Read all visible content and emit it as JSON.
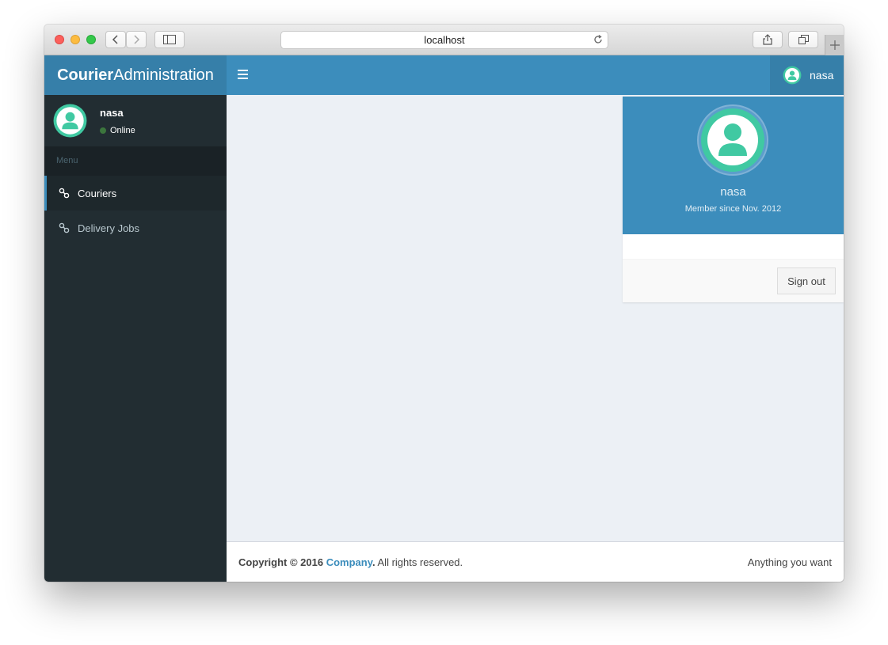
{
  "browser": {
    "address": "localhost"
  },
  "header": {
    "logo_bold": "Courier",
    "logo_light": "Administration",
    "user_name": "nasa"
  },
  "sidebar": {
    "user_name": "nasa",
    "status": "Online",
    "menu_header": "Menu",
    "items": [
      {
        "label": "Couriers",
        "active": true,
        "icon": "link-icon"
      },
      {
        "label": "Delivery Jobs",
        "active": false,
        "icon": "link-icon"
      }
    ]
  },
  "dropdown": {
    "name": "nasa",
    "member_since": "Member since Nov. 2012",
    "sign_out": "Sign out"
  },
  "footer": {
    "copyright_prefix": "Copyright © 2016 ",
    "company": "Company",
    "period": ".",
    "rights": " All rights reserved.",
    "right_text": "Anything you want"
  },
  "colors": {
    "brand": "#3c8dbc",
    "brand_dark": "#367fa9",
    "sidebar_bg": "#222d32",
    "avatar": "#40c9a2"
  }
}
